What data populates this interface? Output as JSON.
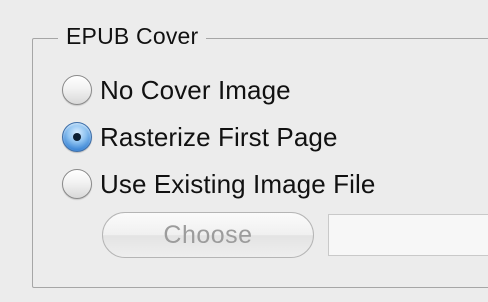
{
  "group": {
    "title": "EPUB Cover"
  },
  "options": [
    {
      "label": "No Cover Image",
      "selected": false
    },
    {
      "label": "Rasterize First Page",
      "selected": true
    },
    {
      "label": "Use Existing Image File",
      "selected": false
    }
  ],
  "choose_button": {
    "label": "Choose",
    "enabled": false
  },
  "path_field": {
    "value": "",
    "enabled": false
  }
}
